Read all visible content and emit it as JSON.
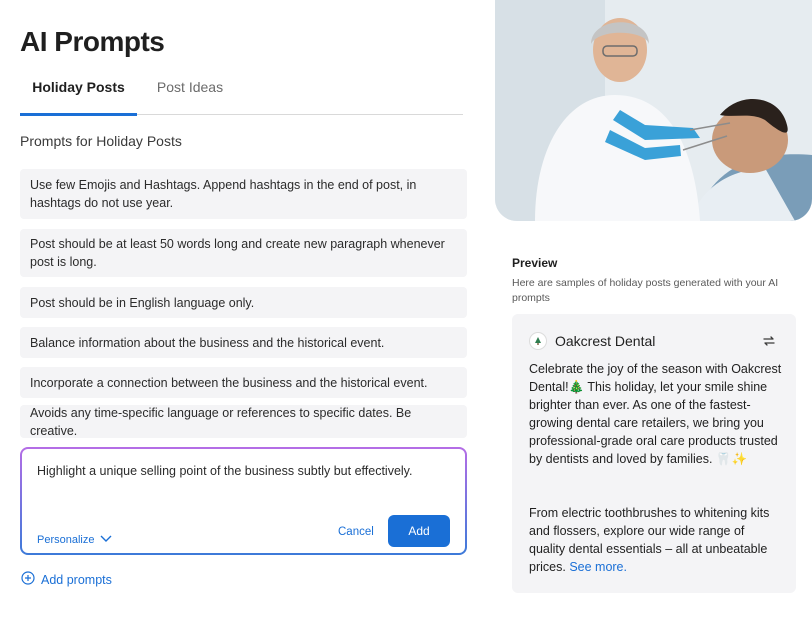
{
  "page": {
    "title": "AI Prompts"
  },
  "tabs": [
    {
      "label": "Holiday Posts",
      "active": true
    },
    {
      "label": "Post Ideas",
      "active": false
    }
  ],
  "section": {
    "title": "Prompts for Holiday Posts"
  },
  "prompts": [
    "Use few Emojis and Hashtags. Append hashtags in the end of post, in hashtags do not use year.",
    "Post should be at least 50 words long and create new paragraph whenever post is long.",
    "Post should be in English language only.",
    "Balance information about the business and the historical event.",
    "Incorporate a connection between the business and the historical event.",
    "Avoids any time-specific language or references to specific dates. Be creative."
  ],
  "editor": {
    "value": "Highlight a unique selling point of the business subtly but effectively.",
    "personalize_label": "Personalize",
    "cancel_label": "Cancel",
    "add_label": "Add"
  },
  "add_prompts_label": "Add prompts",
  "preview": {
    "title": "Preview",
    "description": "Here are samples of holiday posts generated with your AI prompts",
    "business_name": "Oakcrest Dental",
    "paragraph1": "Celebrate the joy of the season with Oakcrest Dental!🎄 This holiday, let your smile shine brighter than ever. As one of the fastest-growing dental care retailers, we bring you professional-grade oral care products trusted by dentists and loved by families. 🦷✨",
    "paragraph2": "From electric toothbrushes to whitening kits and flossers, explore our wide range of quality dental essentials – all at unbeatable prices.",
    "see_more": "See more."
  },
  "colors": {
    "accent": "#1a6fd6",
    "prompt_bg": "#f4f4f6",
    "editor_gradient": [
      "#b56de6",
      "#3c7ad9"
    ]
  },
  "icons": {
    "personalize": "chevron-down-icon",
    "add_prompts": "plus-circle-icon",
    "regenerate": "repeat-icon"
  }
}
